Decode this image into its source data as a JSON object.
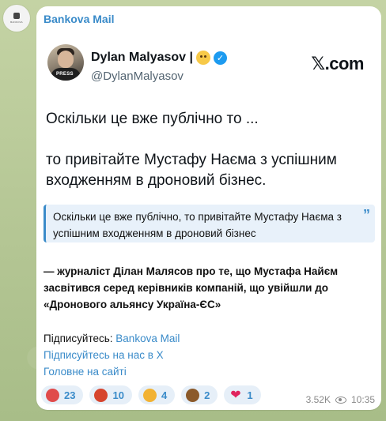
{
  "channel": {
    "name": "Bankova Mail",
    "avatar_text": "BANKOVA"
  },
  "tweet": {
    "author_name": "Dylan Malyasov |",
    "handle": "@DylanMalyasov",
    "badge_label": "PRESS",
    "x_logo_letter": "𝕏",
    "x_logo_suffix": ".com",
    "verified_mark": "✓",
    "text_line1": "Оскільки це вже публічно то ...",
    "text_line2": "то привітайте Мустафу Наєма з успішним входженням в дроновий бізнес."
  },
  "quote": {
    "text": "Оскільки це вже публічно, то привітайте Мустафу Наєма з успішним входженням в дроновий бізнес",
    "icon": "quote-icon",
    "icon_glyph": "”"
  },
  "body": {
    "text": "— журналіст Ділан Малясов про те, що Мустафа Найєм засвітився серед керівників компаній, що увійшли до «Дронового альянсу Україна-ЄС»"
  },
  "links": {
    "subscribe_prefix": "Підписуйтесь: ",
    "subscribe_link": "Bankova Mail",
    "x_link": "Підписуйтесь на нас в X",
    "site_link": "Головне на сайті"
  },
  "reactions": [
    {
      "icon": "clown-icon",
      "glyph": "●",
      "color": "#e04b4b",
      "count": "23"
    },
    {
      "icon": "angry-face-icon",
      "glyph": "●",
      "color": "#d6452e",
      "count": "10"
    },
    {
      "icon": "exploding-head-icon",
      "glyph": "●",
      "color": "#f2b233",
      "count": "4"
    },
    {
      "icon": "poop-icon",
      "glyph": "●",
      "color": "#8b5a2b",
      "count": "2"
    },
    {
      "icon": "heart-icon",
      "glyph": "❤",
      "color": "#e0245e",
      "count": "1"
    }
  ],
  "meta": {
    "views": "3.52K",
    "time": "10:35"
  },
  "colors": {
    "accent": "#3a8bc9",
    "verified": "#1d9bf0",
    "quote_bg": "#e8f1fa"
  }
}
